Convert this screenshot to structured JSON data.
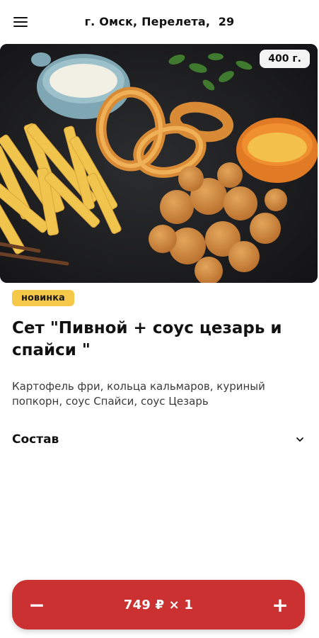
{
  "header": {
    "address": "г. Омск, Перелета,  29",
    "menu_icon": "hamburger-icon"
  },
  "product": {
    "weight": "400 г.",
    "tag": "новинка",
    "title": "Сет \"Пивной + соус цезарь и спайси \"",
    "description": "Картофель фри, кольца кальмаров, куриный попкорн, соус Спайси, соус Цезарь",
    "composition_label": "Состав",
    "composition_icon": "chevron-down-icon"
  },
  "cart": {
    "minus": "−",
    "price_qty": "749 ₽ × 1",
    "plus": "+"
  },
  "colors": {
    "accent": "#cc3131",
    "tag": "#f6c84a"
  }
}
